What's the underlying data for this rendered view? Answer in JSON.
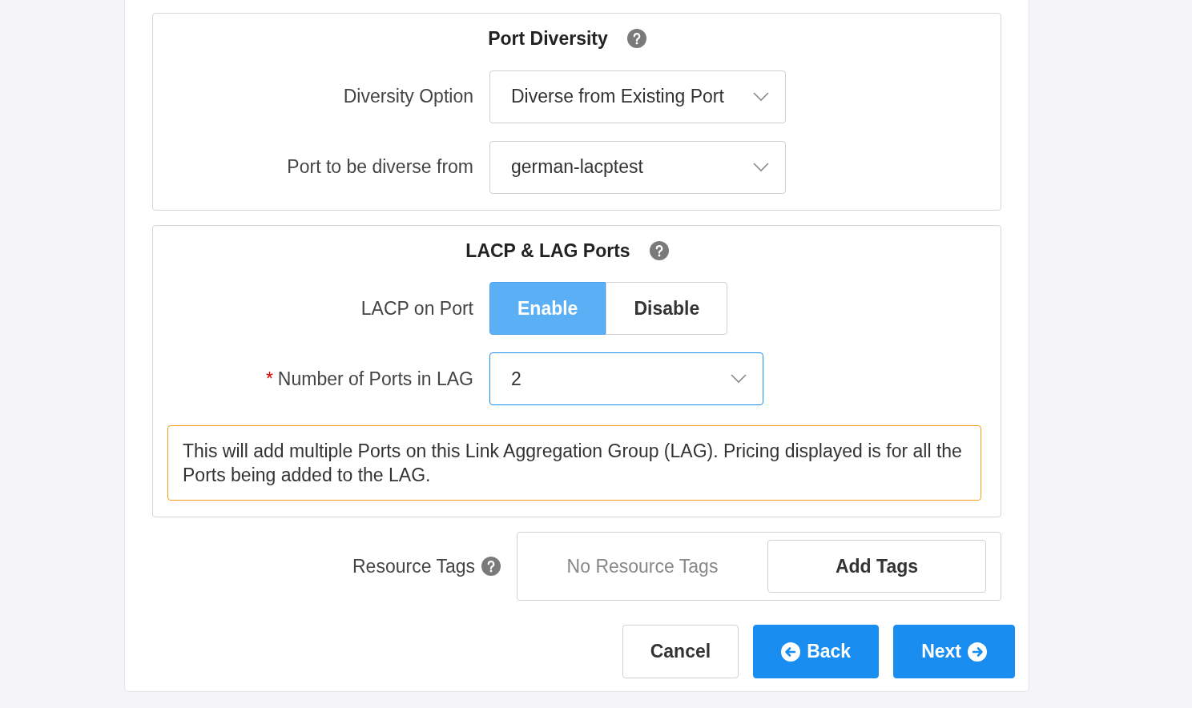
{
  "sections": [
    {
      "title": "Port Diversity",
      "fields": [
        {
          "kind": "select",
          "label": "Diversity Option",
          "focused": false,
          "value": "Diverse from Existing Port"
        },
        {
          "kind": "select",
          "label": "Port to be diverse from",
          "focused": false,
          "value": "german-lacptest"
        }
      ]
    },
    {
      "title": "LACP & LAG Ports",
      "fields": [
        {
          "kind": "toggle",
          "label": "LACP on Port",
          "options": [
            {
              "label": "Enable",
              "selected": true
            },
            {
              "label": "Disable",
              "selected": false
            }
          ]
        },
        {
          "kind": "select",
          "label": "Number of Ports in LAG",
          "required_mark": "*",
          "focused": true,
          "value": "2"
        }
      ],
      "notice": "This will add multiple Ports on this Link Aggregation Group (LAG). Pricing displayed is for all the Ports being added to the LAG."
    }
  ],
  "resource_tags": {
    "label": "Resource Tags",
    "empty_text": "No Resource Tags",
    "button": "Add Tags"
  },
  "actions": [
    {
      "label": "Cancel",
      "kind": "cancel"
    },
    {
      "label": "Back",
      "kind": "back"
    },
    {
      "label": "Next",
      "kind": "next"
    }
  ]
}
